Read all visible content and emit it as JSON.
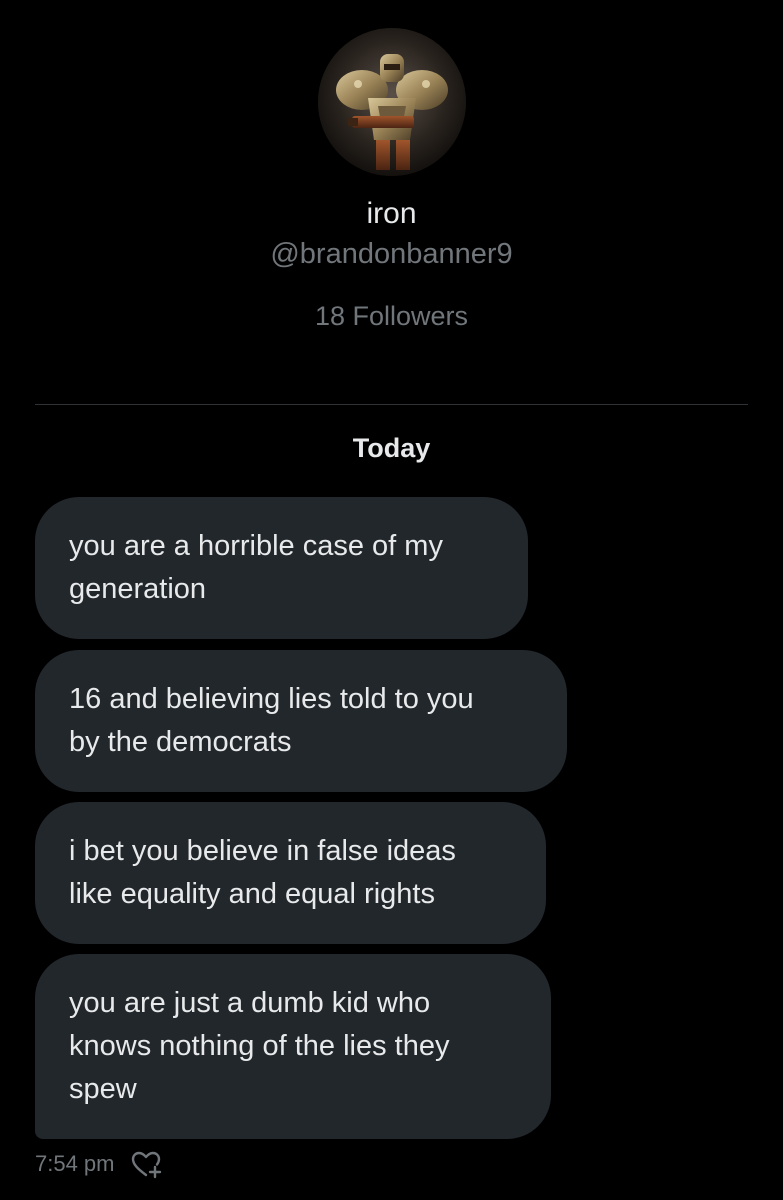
{
  "profile": {
    "avatar_icon": "warrior-armor-avatar",
    "display_name": "iron",
    "handle": "@brandonbanner9",
    "followers": "18 Followers"
  },
  "conversation": {
    "date_separator": "Today",
    "messages": [
      {
        "text_line1": "you are a horrible case of my",
        "text_line2": "generation"
      },
      {
        "text_line1": "16 and believing lies told to you",
        "text_line2": "by the democrats"
      },
      {
        "text_line1": "i bet you believe in false ideas",
        "text_line2": "like equality and equal rights"
      },
      {
        "text_line1": "you are just a dumb kid who",
        "text_line2": "knows nothing of the lies they",
        "text_line3": "spew"
      }
    ],
    "timestamp": "7:54 pm",
    "reaction_icon": "add-reaction-heart-icon"
  },
  "colors": {
    "background": "#000000",
    "bubble": "#22272c",
    "primary_text": "#e7e9ea",
    "secondary_text": "#71767b",
    "divider": "#2f3336"
  }
}
